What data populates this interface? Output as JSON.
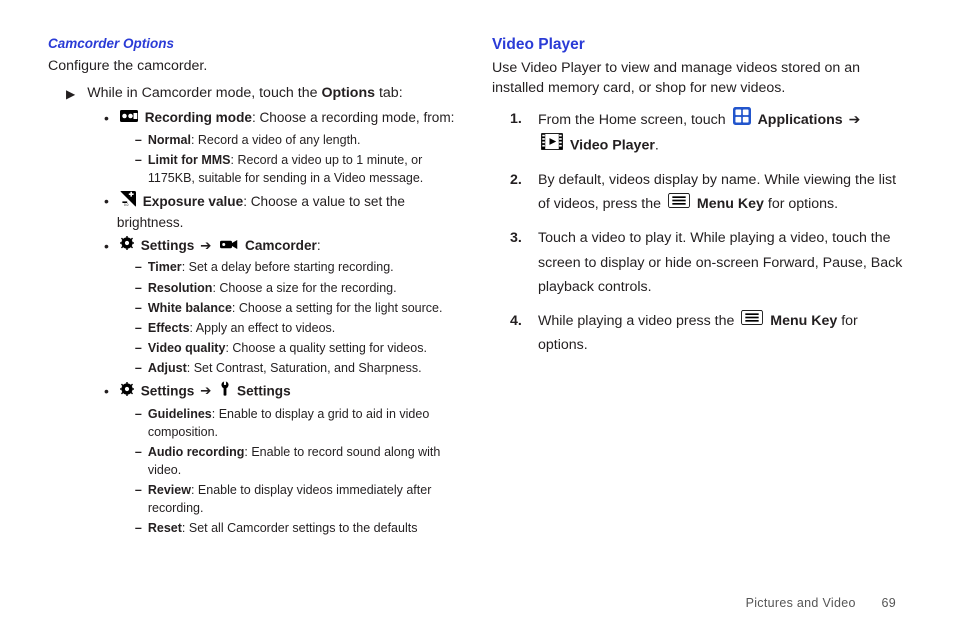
{
  "left": {
    "heading": "Camcorder Options",
    "intro": "Configure the camcorder.",
    "step": {
      "prefix": "While in Camcorder mode, touch the ",
      "bold": "Options",
      "suffix": " tab:"
    },
    "bullets": [
      {
        "icon": "video-mode-icon",
        "label": "Recording mode",
        "desc": ": Choose a recording mode, from:",
        "dashes": [
          {
            "label": "Normal",
            "desc": ": Record a video of any length."
          },
          {
            "label": "Limit for MMS",
            "desc": ": Record a video up to 1 minute, or 1175KB, suitable for sending in a Video message."
          }
        ]
      },
      {
        "icon": "exposure-icon",
        "label": "Exposure value",
        "desc": ": Choose a value to set the brightness."
      },
      {
        "icon": "gear-icon",
        "label": "Settings",
        "arrow": "➔",
        "icon2": "camcorder-icon",
        "label2": "Camcorder",
        "desc": ":",
        "dashes": [
          {
            "label": "Timer",
            "desc": ": Set a delay before starting recording."
          },
          {
            "label": "Resolution",
            "desc": ": Choose a size for the recording."
          },
          {
            "label": "White balance",
            "desc": ": Choose a setting for the light source."
          },
          {
            "label": "Effects",
            "desc": ": Apply an effect to videos."
          },
          {
            "label": "Video quality",
            "desc": ": Choose a quality setting for videos."
          },
          {
            "label": "Adjust",
            "desc": ": Set Contrast, Saturation, and Sharpness."
          }
        ]
      },
      {
        "icon": "gear-icon",
        "label": "Settings",
        "arrow": "➔",
        "icon2": "wrench-icon",
        "label2": "Settings",
        "dashes": [
          {
            "label": "Guidelines",
            "desc": ": Enable to display a grid to aid in video composition."
          },
          {
            "label": "Audio recording",
            "desc": ": Enable to record sound along with video."
          },
          {
            "label": "Review",
            "desc": ": Enable to display videos immediately after recording."
          },
          {
            "label": "Reset",
            "desc": ": Set all Camcorder settings to the defaults"
          }
        ]
      }
    ]
  },
  "right": {
    "heading": "Video Player",
    "intro": "Use Video Player to view and manage videos stored on an installed memory card, or shop for new videos.",
    "steps": [
      {
        "n": "1.",
        "parts": [
          {
            "t": "From the Home screen, touch "
          },
          {
            "icon": "apps-icon"
          },
          {
            "bold": " Applications "
          },
          {
            "arrow": "➔"
          },
          {
            "br": true
          },
          {
            "icon": "video-player-icon"
          },
          {
            "bold": " Video Player"
          },
          {
            "t": "."
          }
        ]
      },
      {
        "n": "2.",
        "parts": [
          {
            "t": "By default, videos display by name. While viewing the list of videos, press the "
          },
          {
            "icon": "menu-key-icon"
          },
          {
            "bold": " Menu Key "
          },
          {
            "t": " for options."
          }
        ]
      },
      {
        "n": "3.",
        "parts": [
          {
            "t": "Touch a video to play it. While playing a video, touch the screen to display or hide on-screen Forward, Pause, Back playback controls."
          }
        ]
      },
      {
        "n": "4.",
        "parts": [
          {
            "t": "While playing a video press the "
          },
          {
            "icon": "menu-key-icon"
          },
          {
            "bold": " Menu Key "
          },
          {
            "t": " for options."
          }
        ]
      }
    ]
  },
  "footer": {
    "section": "Pictures and Video",
    "page": "69"
  },
  "icons": {
    "video-mode-icon": "video-mode",
    "exposure-icon": "exposure",
    "gear-icon": "gear",
    "camcorder-icon": "camcorder",
    "wrench-icon": "wrench",
    "apps-icon": "apps",
    "video-player-icon": "video-player",
    "menu-key-icon": "menu-key"
  }
}
